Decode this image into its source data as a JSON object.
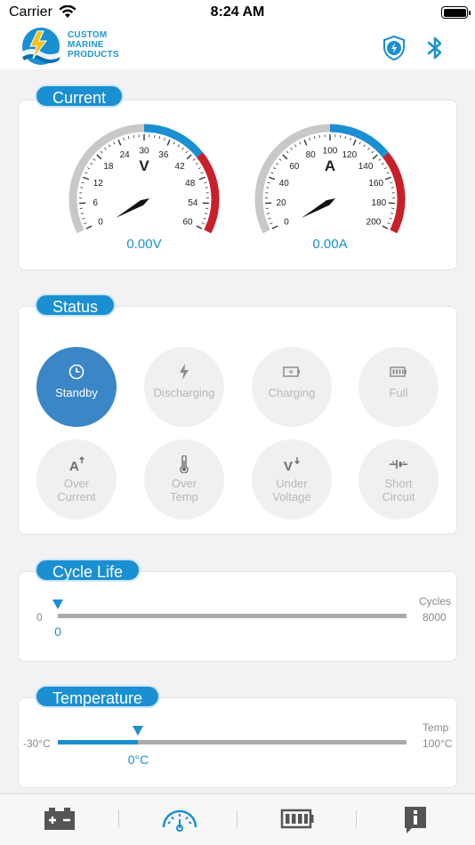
{
  "status_bar": {
    "carrier": "Carrier",
    "time": "8:24 AM"
  },
  "header": {
    "logo_lines": [
      "CUSTOM",
      "MARINE",
      "PRODUCTS"
    ],
    "icons": [
      "shield-bolt-icon",
      "bluetooth-icon"
    ]
  },
  "current": {
    "title": "Current",
    "voltage_gauge": {
      "unit": "V",
      "ticks": [
        "0",
        "6",
        "12",
        "18",
        "24",
        "30",
        "36",
        "42",
        "48",
        "54",
        "60"
      ],
      "value": 0,
      "readout": "0.00V",
      "colors": {
        "normal": "#c8c8c8",
        "mid": "#1a8fd1",
        "high": "#c8202a"
      }
    },
    "amp_gauge": {
      "unit": "A",
      "ticks": [
        "0",
        "20",
        "40",
        "60",
        "80",
        "100",
        "120",
        "140",
        "160",
        "180",
        "200"
      ],
      "value": 0,
      "readout": "0.00A"
    }
  },
  "status": {
    "title": "Status",
    "items": [
      {
        "label": "Standby",
        "icon": "clock-icon",
        "active": true
      },
      {
        "label": "Discharging",
        "icon": "lightning-icon",
        "active": false
      },
      {
        "label": "Charging",
        "icon": "battery-charging-icon",
        "active": false
      },
      {
        "label": "Full",
        "icon": "battery-full-icon",
        "active": false
      },
      {
        "label": "Over\nCurrent",
        "label_lines": [
          "Over",
          "Current"
        ],
        "icon": "amp-up-icon",
        "active": false
      },
      {
        "label_lines": [
          "Over",
          "Temp"
        ],
        "icon": "thermometer-icon",
        "active": false
      },
      {
        "label_lines": [
          "Under",
          "Voltage"
        ],
        "icon": "volt-down-icon",
        "active": false
      },
      {
        "label_lines": [
          "Short",
          "Circuit"
        ],
        "icon": "short-circuit-icon",
        "active": false
      }
    ]
  },
  "cycle_life": {
    "title": "Cycle Life",
    "min": "0",
    "max_label": "Cycles",
    "max": "8000",
    "value": 0,
    "value_label": "0"
  },
  "temperature": {
    "title": "Temperature",
    "min": "-30°C",
    "max_label": "Temp",
    "max": "100°C",
    "value": 0,
    "value_label": "0°C"
  },
  "tab_bar": {
    "tabs": [
      "battery-terminals-icon",
      "gauge-icon",
      "battery-level-icon",
      "info-icon"
    ],
    "active": 1
  }
}
